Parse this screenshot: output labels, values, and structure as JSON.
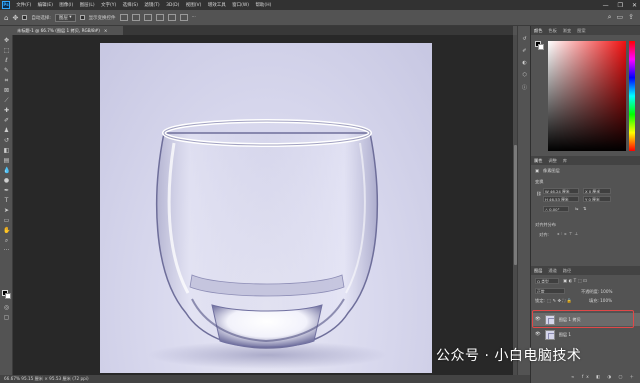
{
  "app": {
    "logo": "Ps"
  },
  "menu": [
    "文件(F)",
    "编辑(E)",
    "图像(I)",
    "图层(L)",
    "文字(Y)",
    "选择(S)",
    "滤镜(T)",
    "3D(D)",
    "视图(V)",
    "增效工具",
    "窗口(W)",
    "帮助(H)"
  ],
  "window_controls": {
    "minimize": "—",
    "restore": "❐",
    "close": "✕"
  },
  "options_bar": {
    "auto_select": "自动选择:",
    "layer_select": "图层",
    "show_transform": "显示变换控件"
  },
  "document_tab": {
    "title": "未标题-1 @ 66.7% (图层 1 拷贝, RGB/8#)",
    "close": "×"
  },
  "status_bar": {
    "text": "66.67%   95.15 厘米 × 95.53 厘米 (72 ppi)"
  },
  "panels": {
    "color_tabs": [
      "颜色",
      "色板",
      "渐变",
      "图案"
    ],
    "properties_tabs": [
      "属性",
      "调整",
      "库"
    ],
    "pixel_layer": "像素图层",
    "transform": {
      "title": "变换",
      "w": "W  46.24 厘米",
      "h": "H  46.53 厘米",
      "x": "X  0 厘米",
      "y": "Y  0 厘米",
      "angle": "△ 0.00°"
    },
    "align": {
      "title": "对齐并分布",
      "sub": "对齐:"
    },
    "layers_tabs": [
      "图层",
      "通道",
      "路径"
    ],
    "layer_filter": "Q 类型",
    "blend_mode": "正常",
    "opacity": "不透明度: 100%",
    "lock": "锁定:",
    "fill": "填充: 100%",
    "layers": [
      {
        "name": "图层 1 拷贝",
        "visible": "👁"
      },
      {
        "name": "图层 1",
        "visible": "👁"
      }
    ]
  },
  "watermark": "公众号 · 小白电脑技术"
}
